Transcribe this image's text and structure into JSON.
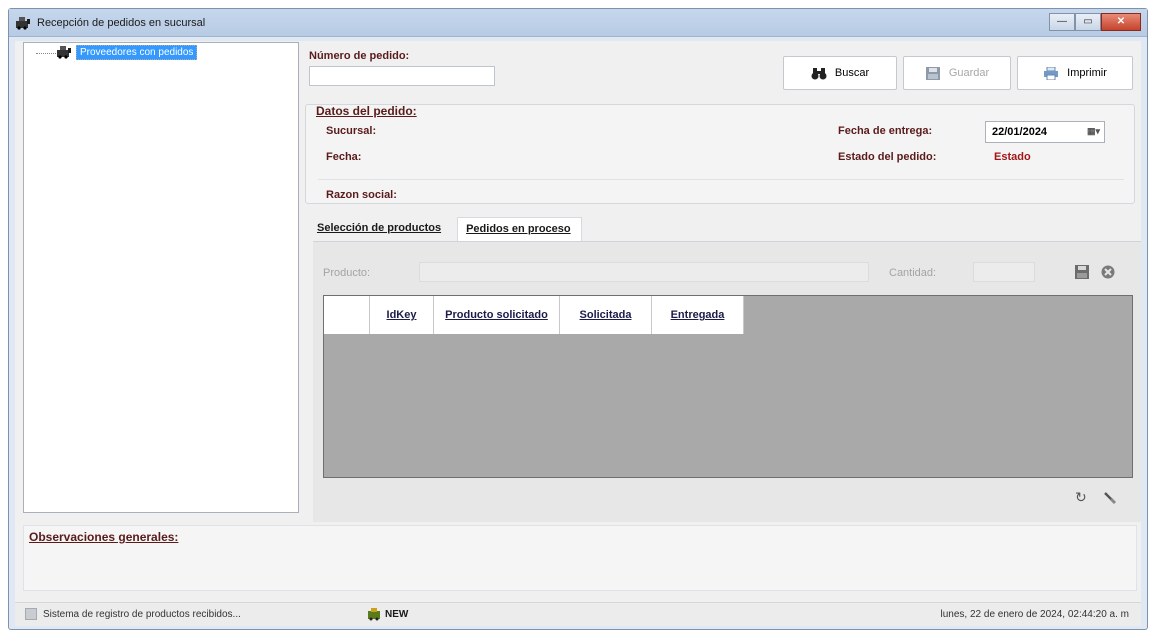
{
  "window": {
    "title": "Recepción de pedidos en sucursal",
    "controls": {
      "minimize": "—",
      "maximize": "▭",
      "close": "✕"
    }
  },
  "tree": {
    "root_label": "Proveedores con pedidos",
    "root_icon": "supplier-icon"
  },
  "order": {
    "number_label": "Número de pedido:",
    "number_value": ""
  },
  "toolbar": {
    "search_label": "Buscar",
    "search_icon": "binoculars-icon",
    "save_label": "Guardar",
    "save_icon": "floppy-disk-icon",
    "print_label": "Imprimir",
    "print_icon": "printer-icon"
  },
  "details": {
    "title": "Datos del pedido:",
    "branch_label": "Sucursal:",
    "date_label": "Fecha:",
    "business_name_label": "Razon social:",
    "delivery_date_label": "Fecha de entrega:",
    "delivery_date_value": "22/01/2024",
    "status_label": "Estado del pedido:",
    "status_value": "Estado",
    "status_color": "#a01818"
  },
  "tabs": [
    {
      "label": "Selección de productos",
      "active": true
    },
    {
      "label": "Pedidos en proceso",
      "active": false
    }
  ],
  "products": {
    "product_label": "Producto:",
    "product_value": "",
    "quantity_label": "Cantidad:",
    "quantity_value": "",
    "save_icon": "floppy-disk-icon",
    "cancel_icon": "cancel-icon"
  },
  "grid": {
    "columns": [
      "IdKey",
      "Producto solicitado",
      "Solicitada",
      "Entregada"
    ],
    "rows": [],
    "refresh_icon": "refresh-icon",
    "clear_icon": "eraser-icon"
  },
  "observations": {
    "title": "Observaciones generales:",
    "value": ""
  },
  "statusbar": {
    "message": "Sistema de registro de productos recibidos...",
    "new_label": "NEW",
    "datetime": "lunes, 22 de enero de 2024, 02:44:20 a. m"
  }
}
